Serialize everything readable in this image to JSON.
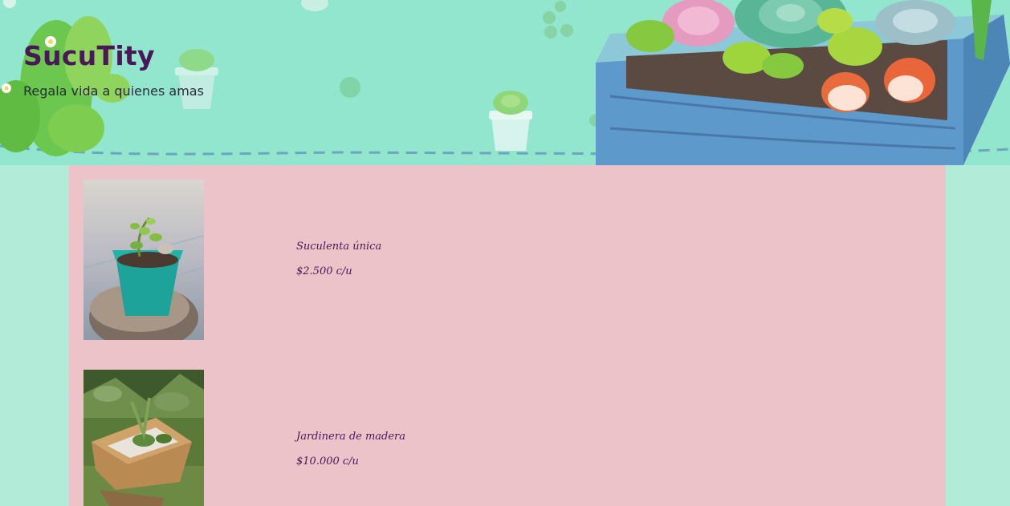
{
  "header": {
    "title": "SucuTity",
    "tagline": "Regala vida a quienes amas"
  },
  "products": [
    {
      "name": "Suculenta única",
      "price": "$2.500 c/u"
    },
    {
      "name": "Jardinera de madera",
      "price": "$10.000 c/u"
    }
  ],
  "colors": {
    "page_background": "#b2ebd8",
    "banner_background": "#92e6cd",
    "content_background": "#ecc3c8",
    "title_color": "#4a1758",
    "price_color": "#4a1758"
  }
}
